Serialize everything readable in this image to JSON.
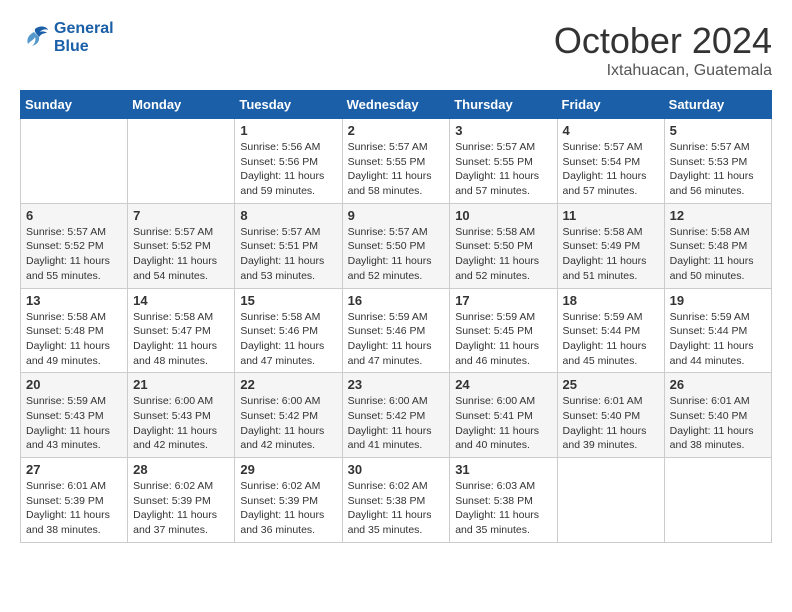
{
  "header": {
    "logo_line1": "General",
    "logo_line2": "Blue",
    "month": "October 2024",
    "location": "Ixtahuacan, Guatemala"
  },
  "weekdays": [
    "Sunday",
    "Monday",
    "Tuesday",
    "Wednesday",
    "Thursday",
    "Friday",
    "Saturday"
  ],
  "weeks": [
    [
      {
        "day": "",
        "sunrise": "",
        "sunset": "",
        "daylight": ""
      },
      {
        "day": "",
        "sunrise": "",
        "sunset": "",
        "daylight": ""
      },
      {
        "day": "1",
        "sunrise": "Sunrise: 5:56 AM",
        "sunset": "Sunset: 5:56 PM",
        "daylight": "Daylight: 11 hours and 59 minutes."
      },
      {
        "day": "2",
        "sunrise": "Sunrise: 5:57 AM",
        "sunset": "Sunset: 5:55 PM",
        "daylight": "Daylight: 11 hours and 58 minutes."
      },
      {
        "day": "3",
        "sunrise": "Sunrise: 5:57 AM",
        "sunset": "Sunset: 5:55 PM",
        "daylight": "Daylight: 11 hours and 57 minutes."
      },
      {
        "day": "4",
        "sunrise": "Sunrise: 5:57 AM",
        "sunset": "Sunset: 5:54 PM",
        "daylight": "Daylight: 11 hours and 57 minutes."
      },
      {
        "day": "5",
        "sunrise": "Sunrise: 5:57 AM",
        "sunset": "Sunset: 5:53 PM",
        "daylight": "Daylight: 11 hours and 56 minutes."
      }
    ],
    [
      {
        "day": "6",
        "sunrise": "Sunrise: 5:57 AM",
        "sunset": "Sunset: 5:52 PM",
        "daylight": "Daylight: 11 hours and 55 minutes."
      },
      {
        "day": "7",
        "sunrise": "Sunrise: 5:57 AM",
        "sunset": "Sunset: 5:52 PM",
        "daylight": "Daylight: 11 hours and 54 minutes."
      },
      {
        "day": "8",
        "sunrise": "Sunrise: 5:57 AM",
        "sunset": "Sunset: 5:51 PM",
        "daylight": "Daylight: 11 hours and 53 minutes."
      },
      {
        "day": "9",
        "sunrise": "Sunrise: 5:57 AM",
        "sunset": "Sunset: 5:50 PM",
        "daylight": "Daylight: 11 hours and 52 minutes."
      },
      {
        "day": "10",
        "sunrise": "Sunrise: 5:58 AM",
        "sunset": "Sunset: 5:50 PM",
        "daylight": "Daylight: 11 hours and 52 minutes."
      },
      {
        "day": "11",
        "sunrise": "Sunrise: 5:58 AM",
        "sunset": "Sunset: 5:49 PM",
        "daylight": "Daylight: 11 hours and 51 minutes."
      },
      {
        "day": "12",
        "sunrise": "Sunrise: 5:58 AM",
        "sunset": "Sunset: 5:48 PM",
        "daylight": "Daylight: 11 hours and 50 minutes."
      }
    ],
    [
      {
        "day": "13",
        "sunrise": "Sunrise: 5:58 AM",
        "sunset": "Sunset: 5:48 PM",
        "daylight": "Daylight: 11 hours and 49 minutes."
      },
      {
        "day": "14",
        "sunrise": "Sunrise: 5:58 AM",
        "sunset": "Sunset: 5:47 PM",
        "daylight": "Daylight: 11 hours and 48 minutes."
      },
      {
        "day": "15",
        "sunrise": "Sunrise: 5:58 AM",
        "sunset": "Sunset: 5:46 PM",
        "daylight": "Daylight: 11 hours and 47 minutes."
      },
      {
        "day": "16",
        "sunrise": "Sunrise: 5:59 AM",
        "sunset": "Sunset: 5:46 PM",
        "daylight": "Daylight: 11 hours and 47 minutes."
      },
      {
        "day": "17",
        "sunrise": "Sunrise: 5:59 AM",
        "sunset": "Sunset: 5:45 PM",
        "daylight": "Daylight: 11 hours and 46 minutes."
      },
      {
        "day": "18",
        "sunrise": "Sunrise: 5:59 AM",
        "sunset": "Sunset: 5:44 PM",
        "daylight": "Daylight: 11 hours and 45 minutes."
      },
      {
        "day": "19",
        "sunrise": "Sunrise: 5:59 AM",
        "sunset": "Sunset: 5:44 PM",
        "daylight": "Daylight: 11 hours and 44 minutes."
      }
    ],
    [
      {
        "day": "20",
        "sunrise": "Sunrise: 5:59 AM",
        "sunset": "Sunset: 5:43 PM",
        "daylight": "Daylight: 11 hours and 43 minutes."
      },
      {
        "day": "21",
        "sunrise": "Sunrise: 6:00 AM",
        "sunset": "Sunset: 5:43 PM",
        "daylight": "Daylight: 11 hours and 42 minutes."
      },
      {
        "day": "22",
        "sunrise": "Sunrise: 6:00 AM",
        "sunset": "Sunset: 5:42 PM",
        "daylight": "Daylight: 11 hours and 42 minutes."
      },
      {
        "day": "23",
        "sunrise": "Sunrise: 6:00 AM",
        "sunset": "Sunset: 5:42 PM",
        "daylight": "Daylight: 11 hours and 41 minutes."
      },
      {
        "day": "24",
        "sunrise": "Sunrise: 6:00 AM",
        "sunset": "Sunset: 5:41 PM",
        "daylight": "Daylight: 11 hours and 40 minutes."
      },
      {
        "day": "25",
        "sunrise": "Sunrise: 6:01 AM",
        "sunset": "Sunset: 5:40 PM",
        "daylight": "Daylight: 11 hours and 39 minutes."
      },
      {
        "day": "26",
        "sunrise": "Sunrise: 6:01 AM",
        "sunset": "Sunset: 5:40 PM",
        "daylight": "Daylight: 11 hours and 38 minutes."
      }
    ],
    [
      {
        "day": "27",
        "sunrise": "Sunrise: 6:01 AM",
        "sunset": "Sunset: 5:39 PM",
        "daylight": "Daylight: 11 hours and 38 minutes."
      },
      {
        "day": "28",
        "sunrise": "Sunrise: 6:02 AM",
        "sunset": "Sunset: 5:39 PM",
        "daylight": "Daylight: 11 hours and 37 minutes."
      },
      {
        "day": "29",
        "sunrise": "Sunrise: 6:02 AM",
        "sunset": "Sunset: 5:39 PM",
        "daylight": "Daylight: 11 hours and 36 minutes."
      },
      {
        "day": "30",
        "sunrise": "Sunrise: 6:02 AM",
        "sunset": "Sunset: 5:38 PM",
        "daylight": "Daylight: 11 hours and 35 minutes."
      },
      {
        "day": "31",
        "sunrise": "Sunrise: 6:03 AM",
        "sunset": "Sunset: 5:38 PM",
        "daylight": "Daylight: 11 hours and 35 minutes."
      },
      {
        "day": "",
        "sunrise": "",
        "sunset": "",
        "daylight": ""
      },
      {
        "day": "",
        "sunrise": "",
        "sunset": "",
        "daylight": ""
      }
    ]
  ]
}
